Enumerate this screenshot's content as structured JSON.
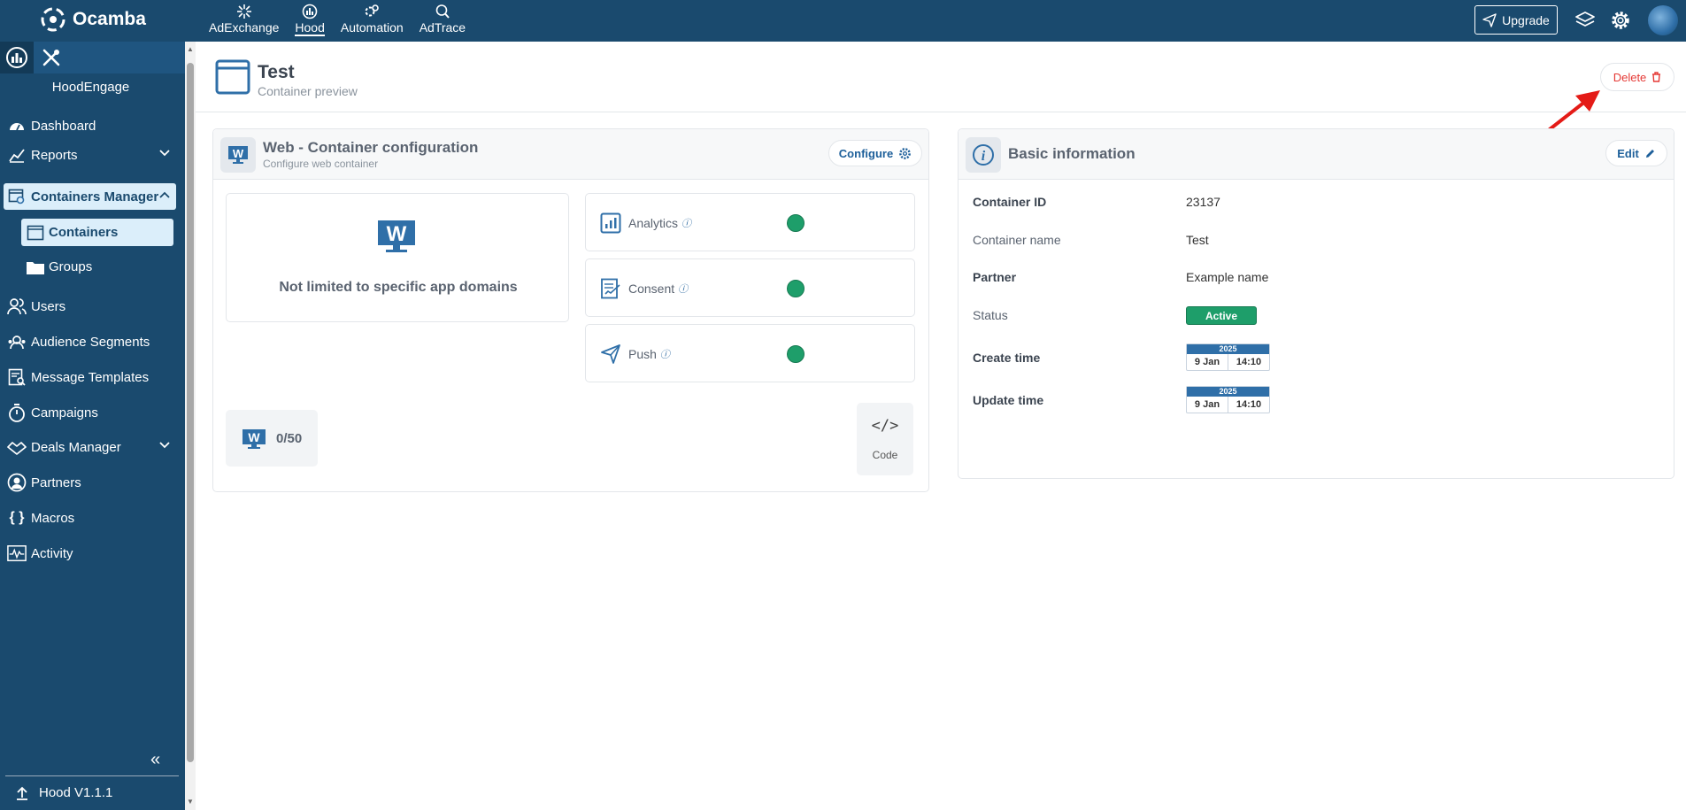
{
  "topbar": {
    "brand": "Ocamba",
    "nav": [
      {
        "label": "AdExchange",
        "icon": "sparkle-icon"
      },
      {
        "label": "Hood",
        "icon": "hood-icon",
        "active": true
      },
      {
        "label": "Automation",
        "icon": "automation-icon"
      },
      {
        "label": "AdTrace",
        "icon": "adtrace-icon"
      }
    ],
    "upgrade_label": "Upgrade"
  },
  "sidebar": {
    "app_name": "HoodEngage",
    "items": [
      {
        "label": "Dashboard",
        "icon": "dashboard-icon"
      },
      {
        "label": "Reports",
        "icon": "reports-icon",
        "expandable": true
      },
      {
        "label": "Containers Manager",
        "icon": "containers-manager-icon",
        "expanded": true,
        "active": true
      },
      {
        "label": "Containers",
        "icon": "window-icon",
        "sub": true,
        "active": true
      },
      {
        "label": "Groups",
        "icon": "folder-icon",
        "sub": true
      },
      {
        "label": "Users",
        "icon": "users-icon"
      },
      {
        "label": "Audience Segments",
        "icon": "audience-icon"
      },
      {
        "label": "Message Templates",
        "icon": "message-templates-icon"
      },
      {
        "label": "Campaigns",
        "icon": "stopwatch-icon"
      },
      {
        "label": "Deals Manager",
        "icon": "deals-icon",
        "expandable": true
      },
      {
        "label": "Partners",
        "icon": "partner-icon"
      },
      {
        "label": "Macros",
        "icon": "braces-icon"
      },
      {
        "label": "Activity",
        "icon": "activity-icon"
      }
    ],
    "footer": "Hood V1.1.1"
  },
  "page": {
    "title": "Test",
    "subtitle": "Container preview",
    "delete_label": "Delete"
  },
  "config_card": {
    "title": "Web - Container configuration",
    "subtitle": "Configure web container",
    "configure_label": "Configure",
    "domain_text": "Not limited to specific app domains",
    "features": [
      {
        "label": "Analytics",
        "icon": "analytics-icon",
        "enabled": true
      },
      {
        "label": "Consent",
        "icon": "consent-icon",
        "enabled": true
      },
      {
        "label": "Push",
        "icon": "send-icon",
        "enabled": true
      }
    ],
    "count": "0/50",
    "code_label": "Code"
  },
  "info_card": {
    "title": "Basic information",
    "edit_label": "Edit",
    "rows": [
      {
        "label": "Container ID",
        "value": "23137"
      },
      {
        "label": "Container name",
        "value": "Test"
      },
      {
        "label": "Partner",
        "value": "Example name"
      },
      {
        "label": "Status",
        "value": "Active"
      },
      {
        "label": "Create time",
        "year": "2025",
        "date": "9 Jan",
        "time": "14:10"
      },
      {
        "label": "Update time",
        "year": "2025",
        "date": "9 Jan",
        "time": "14:10"
      }
    ]
  },
  "colors": {
    "brand": "#1a4a6e",
    "active_status": "#1e9e6a",
    "delete": "#e53935"
  }
}
